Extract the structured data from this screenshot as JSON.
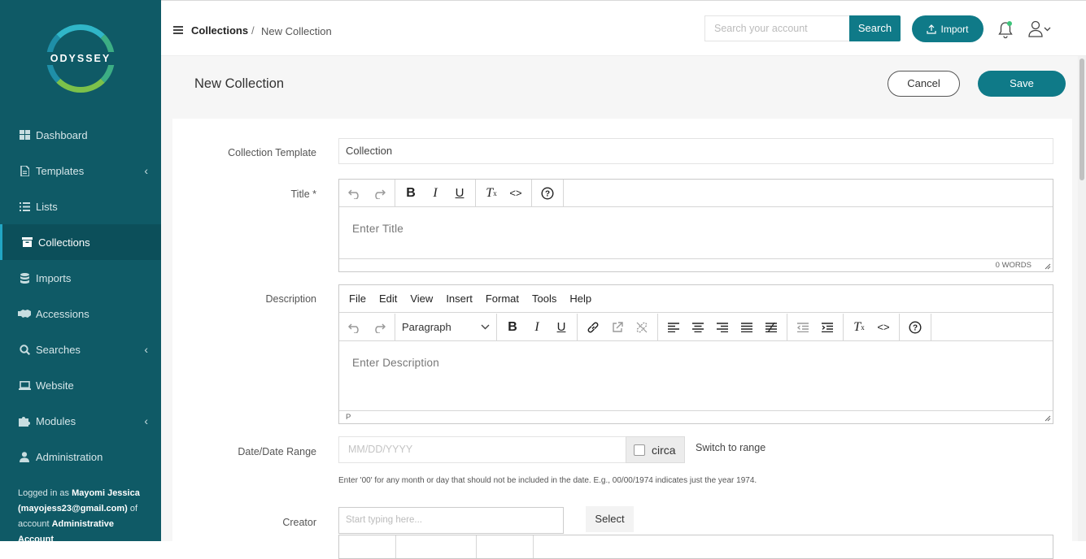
{
  "app": {
    "brand": "ODYSSEY"
  },
  "sidebar": {
    "items": [
      {
        "label": "Dashboard",
        "icon": "dashboard-icon"
      },
      {
        "label": "Templates",
        "icon": "file-icon"
      },
      {
        "label": "Lists",
        "icon": "list-icon"
      },
      {
        "label": "Collections",
        "icon": "archive-icon",
        "active": true
      },
      {
        "label": "Imports",
        "icon": "database-icon"
      },
      {
        "label": "Accessions",
        "icon": "handshake-icon"
      },
      {
        "label": "Searches",
        "icon": "search-icon"
      },
      {
        "label": "Website",
        "icon": "laptop-icon"
      },
      {
        "label": "Modules",
        "icon": "puzzle-icon"
      },
      {
        "label": "Administration",
        "icon": "user-icon"
      }
    ],
    "logged_prefix": "Logged in as",
    "user_name": "Mayomi Jessica",
    "user_email": "(mayojess23@gmail.com)",
    "of_account": "of account",
    "account_name": "Administrative Account"
  },
  "header": {
    "breadcrumb_root": "Collections",
    "breadcrumb_sep": "/",
    "breadcrumb_current": "New Collection",
    "search_placeholder": "Search your account",
    "search_label": "Search",
    "import_label": "Import"
  },
  "page": {
    "title": "New Collection",
    "cancel_label": "Cancel",
    "save_label": "Save"
  },
  "form": {
    "template_label": "Collection Template",
    "template_value": "Collection",
    "title_label": "Title *",
    "title_placeholder": "Enter Title",
    "title_word_count": "0 WORDS",
    "description_label": "Description",
    "menus": [
      "File",
      "Edit",
      "View",
      "Insert",
      "Format",
      "Tools",
      "Help"
    ],
    "block_format": "Paragraph",
    "description_placeholder": "Enter Description",
    "description_path": "P",
    "date_label": "Date/Date Range",
    "date_placeholder": "MM/DD/YYYY",
    "circa_label": "circa",
    "switch_range_label": "Switch to range",
    "date_note": "Enter '00' for any month or day that should not be included in the date. E.g., 00/00/1974 indicates just the year 1974.",
    "creator_label": "Creator",
    "creator_placeholder": "Start typing here...",
    "select_label": "Select"
  },
  "colors": {
    "sidebar": "#0f5a66",
    "accent": "#0f7a88",
    "notification": "#3cc47a"
  }
}
